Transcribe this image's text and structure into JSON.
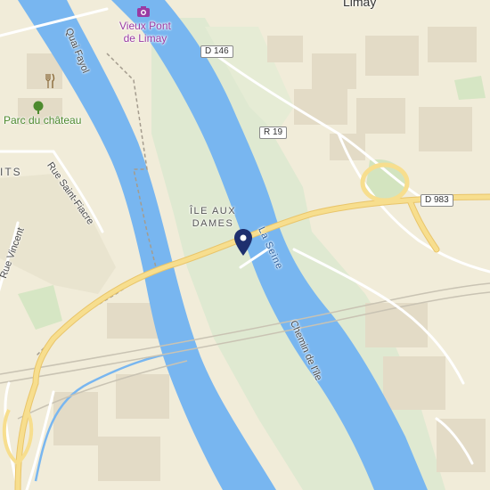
{
  "labels": {
    "town_top": "Limay",
    "poi_bridge": "Vieux Pont\nde Limay",
    "poi_park": "Parc du château",
    "street_quai": "Quai Fayol",
    "street_fiacre": "Rue Saint-Fiacre",
    "street_vincent": "Rue Vincent",
    "district_left": "ITS",
    "island": "ÎLE AUX\nDAMES",
    "river": "La Seine",
    "street_chemin": "Chemin de l'île"
  },
  "shields": {
    "d146": "D 146",
    "r19": "R 19",
    "d983": "D 983"
  },
  "colors": {
    "land": "#f1ecd9",
    "water": "#78b6f0",
    "green": "#dfe9d1",
    "major_road": "#f5d57a",
    "minor_road": "#ffffff",
    "marker": "#1e2f6e",
    "poi_purple": "#9a3aa3",
    "park_green": "#4d8a2e"
  },
  "icons": {
    "camera": "camera-icon",
    "restaurant": "fork-knife-icon",
    "tree": "tree-icon",
    "marker": "location-pin-icon"
  }
}
